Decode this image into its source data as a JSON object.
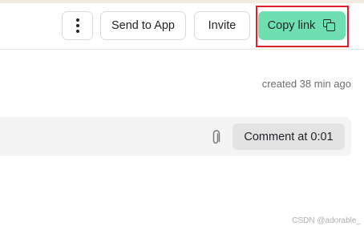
{
  "toolbar": {
    "more_icon": "kebab-vertical-icon",
    "send_to_app_label": "Send to App",
    "invite_label": "Invite",
    "copy_link_label": "Copy link",
    "copy_icon": "copy-icon",
    "highlight_color": "#e0202c",
    "accent_color": "#6fdfb1"
  },
  "meta": {
    "created_text": "created 38 min ago"
  },
  "comment": {
    "attach_icon": "paperclip-icon",
    "button_label": "Comment at 0:01"
  },
  "watermark": {
    "text": "CSDN @adorable_"
  }
}
